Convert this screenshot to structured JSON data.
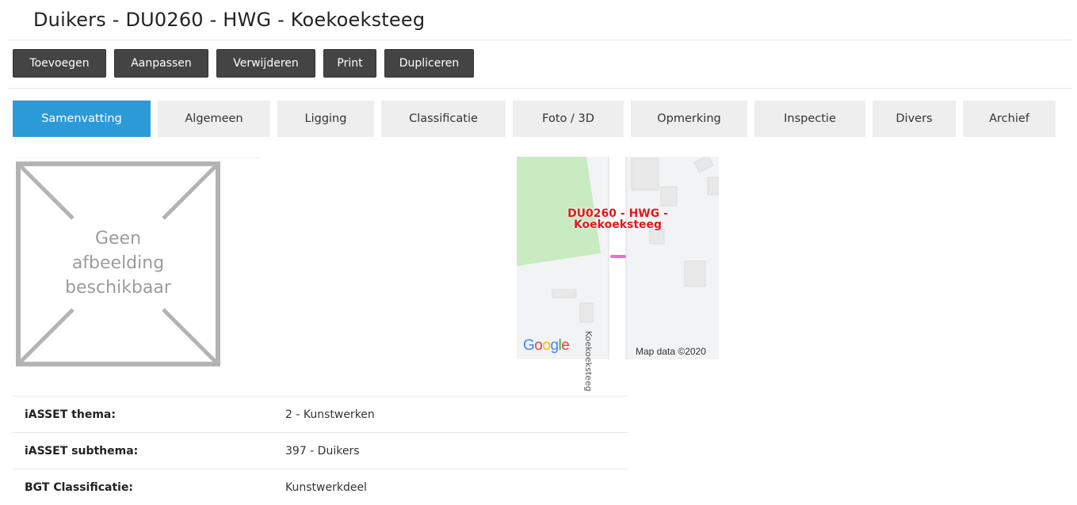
{
  "page": {
    "title": "Duikers - DU0260 - HWG - Koekoeksteeg"
  },
  "toolbar": {
    "buttons": [
      "Toevoegen",
      "Aanpassen",
      "Verwijderen",
      "Print",
      "Dupliceren"
    ]
  },
  "tabs": {
    "active": "Samenvatting",
    "items": [
      "Samenvatting",
      "Algemeen",
      "Ligging",
      "Classificatie",
      "Foto / 3D",
      "Opmerking",
      "Inspectie",
      "Divers",
      "Archief"
    ]
  },
  "photo": {
    "placeholder": "Geen afbeelding beschikbaar",
    "placeholder_lines": [
      "Geen",
      "afbeelding",
      "beschikbaar"
    ]
  },
  "map": {
    "marker_label_lines": [
      "DU0260 - HWG -",
      "Koekoeksteeg"
    ],
    "road_label": "Koekoeksteeg",
    "provider": "Google",
    "attribution": "Map data ©2020"
  },
  "properties": [
    {
      "label": "iASSET thema:",
      "value": "2 - Kunstwerken"
    },
    {
      "label": "iASSET subthema:",
      "value": "397 - Duikers"
    },
    {
      "label": "BGT Classificatie:",
      "value": "Kunstwerkdeel"
    }
  ],
  "colors": {
    "accent": "#2d9ad8",
    "toolbar_button": "#444444",
    "map_label": "#e5161d",
    "map_marker": "#e96fe0"
  }
}
